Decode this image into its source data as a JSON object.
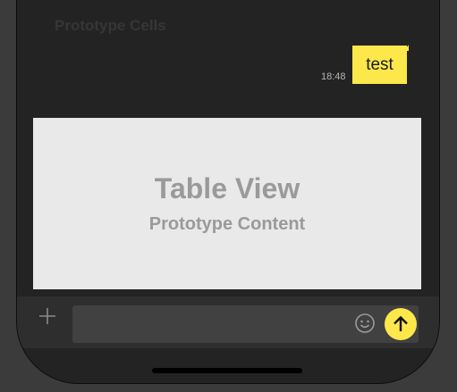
{
  "section_header": "Prototype Cells",
  "message": {
    "time": "18:48",
    "text": "test"
  },
  "table_view": {
    "title": "Table View",
    "subtitle": "Prototype Content"
  },
  "input_bar": {
    "placeholder": "",
    "icons": [
      "plus-icon",
      "emoji-icon",
      "arrow-up-icon"
    ]
  },
  "colors": {
    "accent": "#fce84a",
    "background": "#232323",
    "table_view": "#e9e9e9"
  }
}
